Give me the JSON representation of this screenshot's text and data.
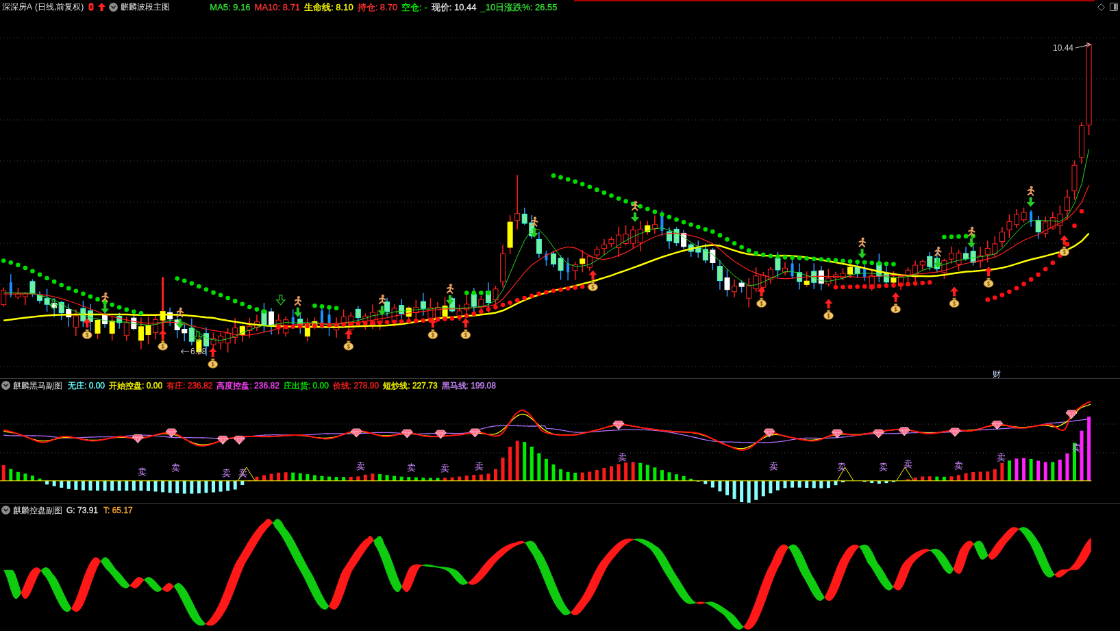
{
  "main_panel": {
    "symbol": "深深房A",
    "period": "(日线,前复权)",
    "indicator": "麒麟波段主图",
    "readouts": [
      {
        "text": "MA5: 9.16",
        "color": "#33dd33"
      },
      {
        "text": "MA10: 8.71",
        "color": "#ff3333"
      },
      {
        "text": "生命线: 8.10",
        "color": "#ffff00"
      },
      {
        "text": "持仓: 8.70",
        "color": "#ff3333"
      },
      {
        "text": "空仓: -",
        "color": "#00ff00"
      },
      {
        "text": "现价: 10.44",
        "color": "#e0e0e0"
      },
      {
        "text": "_10日涨跌%: 26.55",
        "color": "#33dd33"
      }
    ],
    "high_label": "10.44",
    "low_label": "6.68",
    "event_marker": "财"
  },
  "sub_panel_1": {
    "title": "麒麟黑马副图",
    "readouts": [
      {
        "text": "无庄: 0.00",
        "color": "#66ffff"
      },
      {
        "text": "开始控盘: 0.00",
        "color": "#ffff00"
      },
      {
        "text": "有庄: 236.82",
        "color": "#ff2020"
      },
      {
        "text": "高度控盘: 236.82",
        "color": "#ff44ff"
      },
      {
        "text": "庄出货: 0.00",
        "color": "#00ee00"
      },
      {
        "text": "价线: 278.90",
        "color": "#ff2020"
      },
      {
        "text": "短炒线: 227.73",
        "color": "#ffff00"
      },
      {
        "text": "黑马线: 199.08",
        "color": "#cc88ff"
      }
    ],
    "sell_signals": [
      "卖",
      "卖",
      "卖",
      "卖",
      "卖",
      "卖",
      "卖",
      "卖",
      "卖",
      "卖",
      "卖",
      "卖",
      "卖",
      "卖",
      "卖",
      "卖"
    ]
  },
  "sub_panel_2": {
    "title": "麒麟控盘副图",
    "readouts": [
      {
        "text": "G: 73.91",
        "color": "#e0e0e0"
      },
      {
        "text": "T: 65.17",
        "color": "#ffaa33"
      }
    ]
  }
}
